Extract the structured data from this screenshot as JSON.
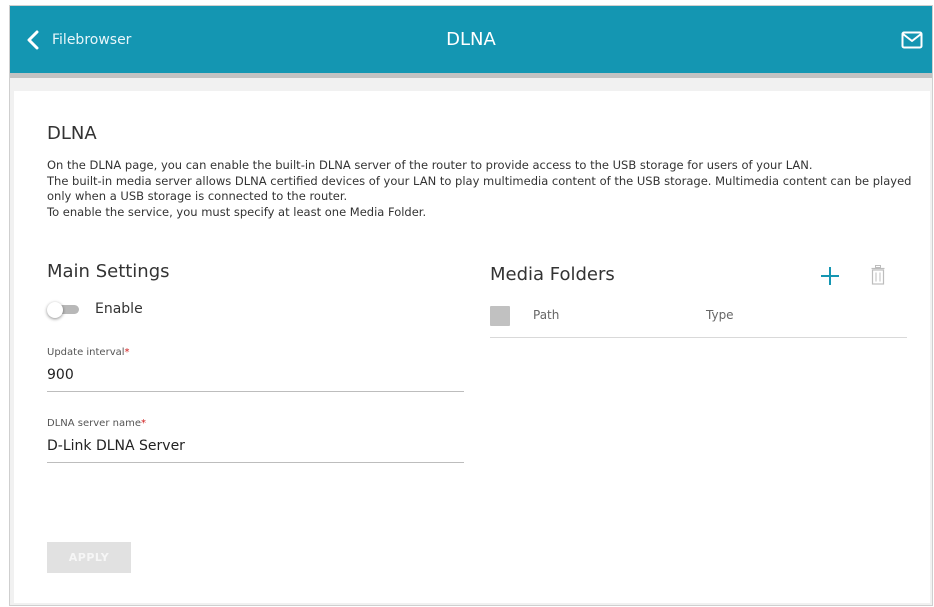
{
  "header": {
    "back_label": "Filebrowser",
    "title": "DLNA",
    "background": "#1496b2",
    "icons": {
      "back": "chevron-left-icon",
      "mail": "mail-icon"
    }
  },
  "page": {
    "heading": "DLNA",
    "description": [
      "On the DLNA page, you can enable the built-in DLNA server of the router to provide access to the USB storage for users of your LAN.",
      "The built-in media server allows DLNA certified devices of your LAN to play multimedia content of the USB storage. Multimedia content can be played only when a USB storage is connected to the router.",
      "To enable the service, you must specify at least one Media Folder."
    ]
  },
  "main_settings": {
    "title": "Main Settings",
    "enable": {
      "label": "Enable",
      "checked": false
    },
    "update_interval": {
      "label": "Update interval",
      "required_mark": "*",
      "value": "900"
    },
    "server_name": {
      "label": "DLNA server name",
      "required_mark": "*",
      "value": "D-Link DLNA Server"
    }
  },
  "media_folders": {
    "title": "Media Folders",
    "columns": [
      "Path",
      "Type"
    ],
    "rows": [],
    "icons": {
      "add": "plus-icon",
      "delete": "trash-icon"
    }
  },
  "actions": {
    "apply_label": "APPLY",
    "apply_enabled": false
  }
}
